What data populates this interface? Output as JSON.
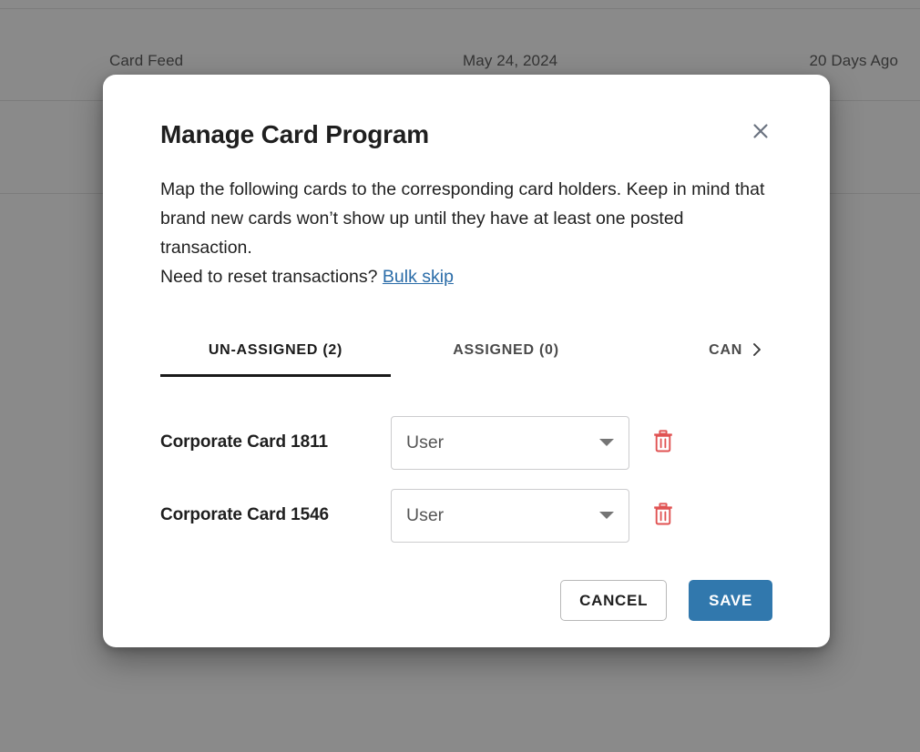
{
  "background": {
    "row": {
      "feed_label": "Card Feed",
      "date": "May 24, 2024",
      "age": "20 Days Ago"
    }
  },
  "modal": {
    "title": "Manage Card Program",
    "close_icon": "close-icon",
    "description_line1": "Map the following cards to the corresponding card holders. Keep in mind that brand new cards won’t show up until they have at least one posted transaction.",
    "reset_prompt": "Need to reset transactions? ",
    "bulk_skip_label": "Bulk skip",
    "tabs": [
      {
        "label": "UN-ASSIGNED (2)",
        "active": true
      },
      {
        "label": "ASSIGNED (0)",
        "active": false
      },
      {
        "label": "CANCE",
        "active": false
      }
    ],
    "tab_scroll_right_icon": "chevron-right-icon",
    "cards": [
      {
        "name": "Corporate Card 1811",
        "assignee_value": "User",
        "caret_icon": "chevron-down-icon",
        "delete_icon": "trash-icon"
      },
      {
        "name": "Corporate Card 1546",
        "assignee_value": "User",
        "caret_icon": "chevron-down-icon",
        "delete_icon": "trash-icon"
      }
    ],
    "footer": {
      "cancel_label": "CANCEL",
      "save_label": "SAVE"
    }
  },
  "colors": {
    "accent_blue": "#3178ad",
    "link_blue": "#2a6ca8",
    "delete_red": "#e05252",
    "scrim": "rgba(66,66,66,0.62)",
    "tab_active": "#1a1a1a"
  }
}
